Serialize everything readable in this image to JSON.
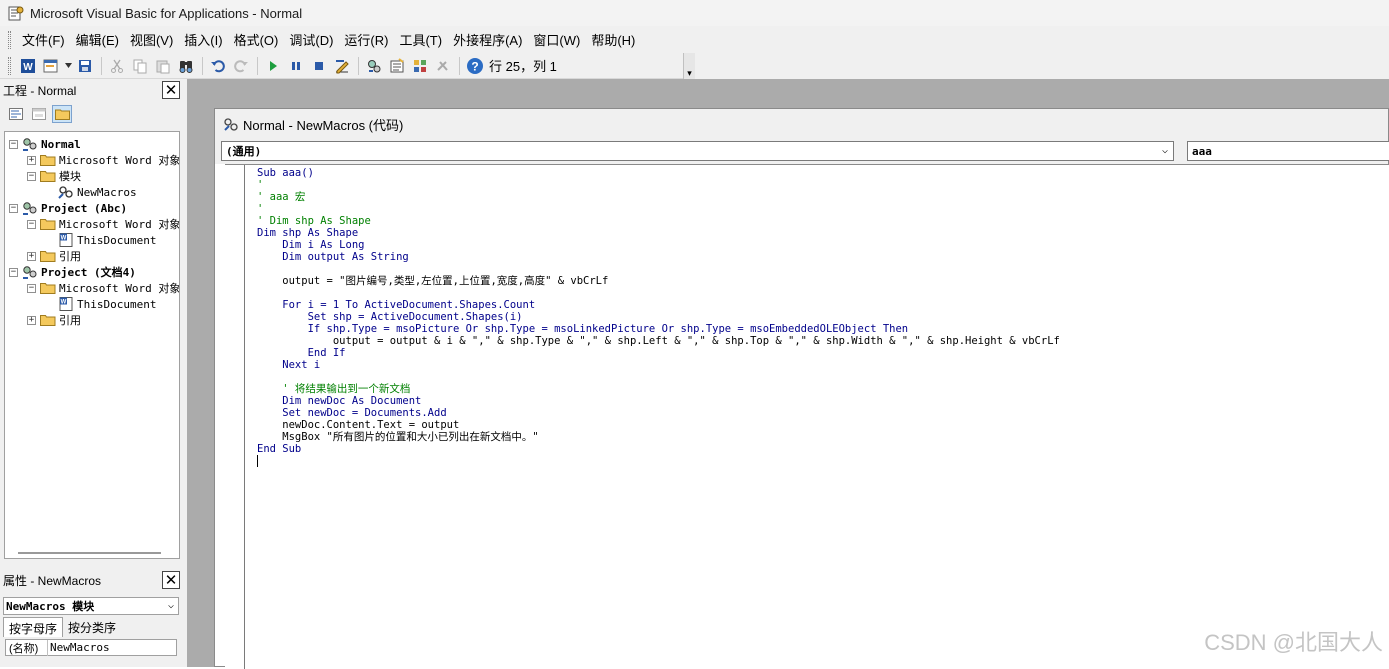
{
  "window": {
    "title": "Microsoft Visual Basic for Applications - Normal"
  },
  "menu": [
    "文件(F)",
    "编辑(E)",
    "视图(V)",
    "插入(I)",
    "格式(O)",
    "调试(D)",
    "运行(R)",
    "工具(T)",
    "外接程序(A)",
    "窗口(W)",
    "帮助(H)"
  ],
  "toolbar": {
    "position": "行 25，列 1",
    "icons": [
      "word-icon",
      "insert-userform-icon",
      "save-icon",
      "cut-icon",
      "copy-icon",
      "paste-icon",
      "find-icon",
      "undo-icon",
      "redo-icon",
      "run-icon",
      "break-icon",
      "reset-icon",
      "design-mode-icon",
      "project-explorer-icon",
      "properties-icon",
      "object-browser-icon",
      "toolbox-icon",
      "help-icon"
    ]
  },
  "project_pane": {
    "title": "工程 - Normal",
    "tree": [
      {
        "label": "Normal",
        "level": 0,
        "expander": "−",
        "icon": "project",
        "bold": true
      },
      {
        "label": "Microsoft Word 对象",
        "level": 1,
        "expander": "+",
        "icon": "folder"
      },
      {
        "label": "模块",
        "level": 1,
        "expander": "−",
        "icon": "folder"
      },
      {
        "label": "NewMacros",
        "level": 2,
        "expander": "",
        "icon": "module"
      },
      {
        "label": "Project (Abc)",
        "level": 0,
        "expander": "−",
        "icon": "project",
        "bold": true
      },
      {
        "label": "Microsoft Word 对象",
        "level": 1,
        "expander": "−",
        "icon": "folder"
      },
      {
        "label": "ThisDocument",
        "level": 2,
        "expander": "",
        "icon": "document"
      },
      {
        "label": "引用",
        "level": 1,
        "expander": "+",
        "icon": "folder"
      },
      {
        "label": "Project (文档4)",
        "level": 0,
        "expander": "−",
        "icon": "project",
        "bold": true
      },
      {
        "label": "Microsoft Word 对象",
        "level": 1,
        "expander": "−",
        "icon": "folder"
      },
      {
        "label": "ThisDocument",
        "level": 2,
        "expander": "",
        "icon": "document"
      },
      {
        "label": "引用",
        "level": 1,
        "expander": "+",
        "icon": "folder"
      }
    ]
  },
  "properties_pane": {
    "title": "属性 - NewMacros",
    "object": "NewMacros 模块",
    "tabs": [
      "按字母序",
      "按分类序"
    ],
    "row": {
      "key": "(名称)",
      "value": "NewMacros"
    }
  },
  "code_window": {
    "title": "Normal - NewMacros (代码)",
    "object_combo": "(通用)",
    "proc_combo": "aaa",
    "lines": [
      {
        "t": "Sub aaa()",
        "k": "kw"
      },
      {
        "t": "'",
        "k": "cm"
      },
      {
        "t": "' aaa 宏",
        "k": "cm"
      },
      {
        "t": "'",
        "k": "cm"
      },
      {
        "t": "' Dim shp As Shape",
        "k": "cm"
      },
      {
        "t": "Dim shp As Shape",
        "k": "kw"
      },
      {
        "t": "    Dim i As Long",
        "k": "kw"
      },
      {
        "t": "    Dim output As String",
        "k": "kw"
      },
      {
        "t": "",
        "k": ""
      },
      {
        "t": "    output = \"图片编号,类型,左位置,上位置,宽度,高度\" & vbCrLf",
        "k": ""
      },
      {
        "t": "",
        "k": ""
      },
      {
        "t": "    For i = 1 To ActiveDocument.Shapes.Count",
        "k": "kw"
      },
      {
        "t": "        Set shp = ActiveDocument.Shapes(i)",
        "k": "kw"
      },
      {
        "t": "        If shp.Type = msoPicture Or shp.Type = msoLinkedPicture Or shp.Type = msoEmbeddedOLEObject Then",
        "k": "kw"
      },
      {
        "t": "            output = output & i & \",\" & shp.Type & \",\" & shp.Left & \",\" & shp.Top & \",\" & shp.Width & \",\" & shp.Height & vbCrLf",
        "k": ""
      },
      {
        "t": "        End If",
        "k": "kw"
      },
      {
        "t": "    Next i",
        "k": "kw"
      },
      {
        "t": "",
        "k": ""
      },
      {
        "t": "    ' 将结果输出到一个新文档",
        "k": "cm"
      },
      {
        "t": "    Dim newDoc As Document",
        "k": "kw"
      },
      {
        "t": "    Set newDoc = Documents.Add",
        "k": "kw"
      },
      {
        "t": "    newDoc.Content.Text = output",
        "k": ""
      },
      {
        "t": "    MsgBox \"所有图片的位置和大小已列出在新文档中。\"",
        "k": ""
      },
      {
        "t": "End Sub",
        "k": "kw"
      },
      {
        "t": "",
        "k": "caret"
      }
    ]
  },
  "watermark": "CSDN @北国大人"
}
